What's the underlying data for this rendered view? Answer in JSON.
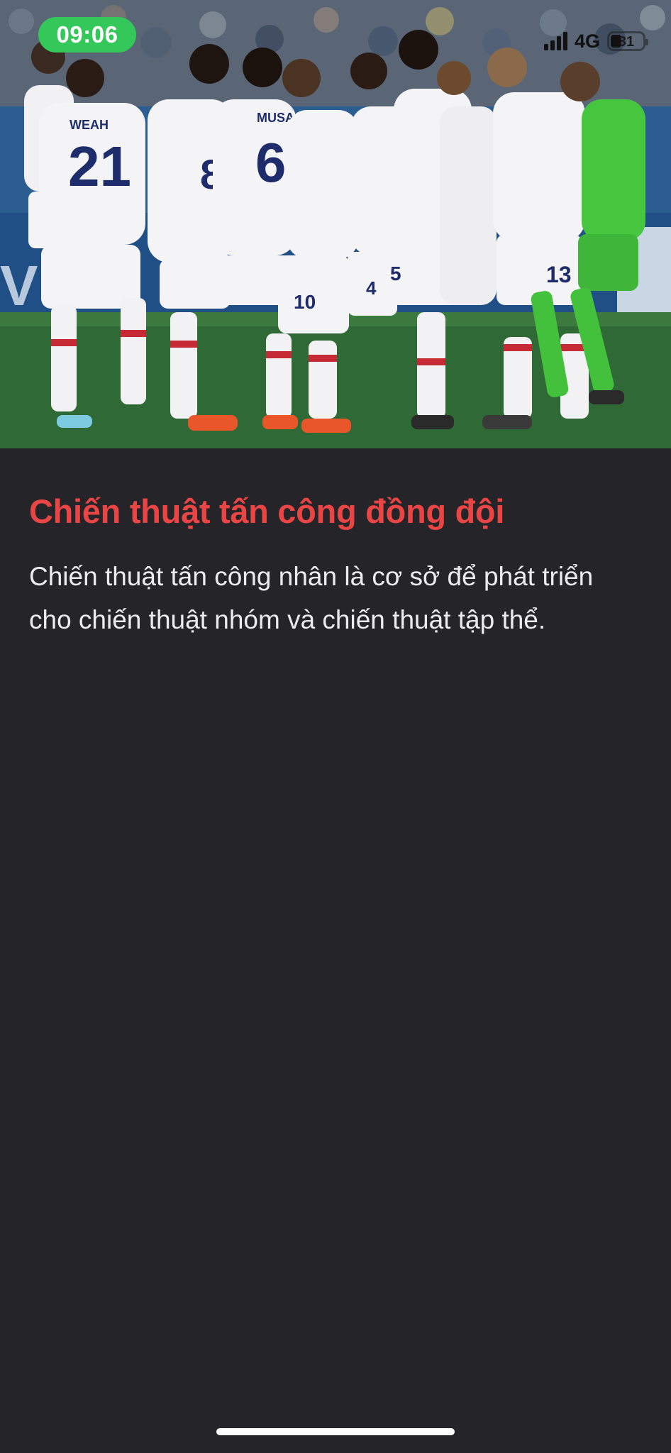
{
  "status_bar": {
    "time": "09:06",
    "network": "4G",
    "battery_level": "31"
  },
  "hero": {
    "icon": "team-photo-image",
    "jersey_names": [
      "WEAH",
      "MUSAH"
    ],
    "jersey_numbers": [
      "21",
      "6",
      "8",
      "10",
      "5",
      "4",
      "13"
    ],
    "colors": {
      "kit_white": "#f4f4f6",
      "kit_navy": "#1f2c6b",
      "kit_red": "#c62a35",
      "keeper_green": "#46c63f",
      "pitch": "#2f6a36"
    }
  },
  "article": {
    "title": "Chiến thuật tấn công đồng đội",
    "body": "Chiến thuật tấn công nhân là cơ sở để phát triển cho chiến thuật nhóm và chiến thuật tập thể."
  },
  "theme": {
    "background": "#252429",
    "title_color": "#e94545",
    "body_color": "#ececef",
    "time_pill_color": "#34c759"
  }
}
